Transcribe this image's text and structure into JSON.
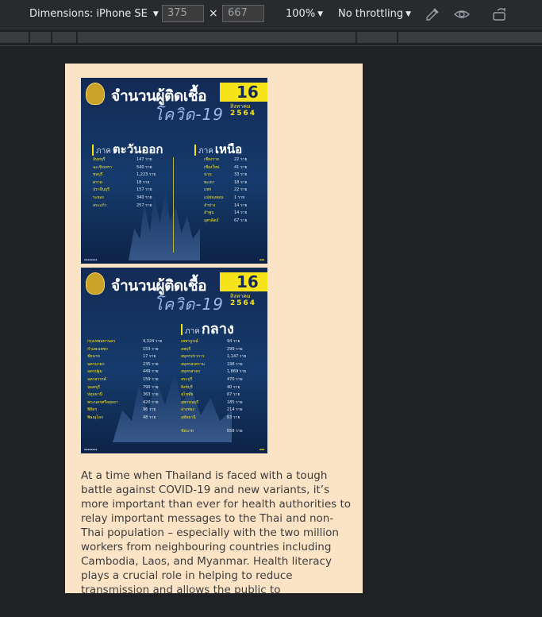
{
  "toolbar": {
    "dimensions_label": "Dimensions: iPhone SE",
    "width": "375",
    "height": "667",
    "times": "×",
    "zoom": "100%",
    "throttling": "No throttling",
    "dropdown_glyph": "▼",
    "icons": [
      "eyedropper-icon",
      "visibility-icon",
      "rotate-icon"
    ]
  },
  "card1": {
    "headline": "จำนวนผู้ติดเชื้อ",
    "subhead": "โควิด-19",
    "day": "16",
    "month": "สิงหาคม",
    "year": "2564",
    "left_region": {
      "prefix": "ภาค",
      "name": "ตะวันออก"
    },
    "right_region": {
      "prefix": "ภาค",
      "name": "เหนือ"
    },
    "left_rows": [
      {
        "p": "จันทบุรี",
        "v": "147 ราย"
      },
      {
        "p": "ฉะเชิงเทรา",
        "v": "540 ราย"
      },
      {
        "p": "ชลบุรี",
        "v": "1,223 ราย"
      },
      {
        "p": "ตราด",
        "v": "18 ราย"
      },
      {
        "p": "ปราจีนบุรี",
        "v": "157 ราย"
      },
      {
        "p": "ระยอง",
        "v": "340 ราย"
      },
      {
        "p": "สระแก้ว",
        "v": "257 ราย"
      }
    ],
    "right_rows": [
      {
        "p": "เชียงราย",
        "v": "22 ราย"
      },
      {
        "p": "เชียงใหม่",
        "v": "41 ราย"
      },
      {
        "p": "น่าน",
        "v": "33 ราย"
      },
      {
        "p": "พะเยา",
        "v": "18 ราย"
      },
      {
        "p": "แพร่",
        "v": "22 ราย"
      },
      {
        "p": "แม่ฮ่องสอน",
        "v": "1 ราย"
      },
      {
        "p": "ลำปาง",
        "v": "14 ราย"
      },
      {
        "p": "ลำพูน",
        "v": "14 ราย"
      },
      {
        "p": "อุตรดิตถ์",
        "v": "67 ราย"
      }
    ]
  },
  "card2": {
    "headline": "จำนวนผู้ติดเชื้อ",
    "subhead": "โควิด-19",
    "day": "16",
    "month": "สิงหาคม",
    "year": "2564",
    "region": {
      "prefix": "ภาค",
      "name": "กลาง"
    },
    "left_rows": [
      {
        "p": "กรุงเทพมหานคร",
        "v": "4,324 ราย"
      },
      {
        "p": "กำแพงเพชร",
        "v": "153 ราย"
      },
      {
        "p": "ชัยนาท",
        "v": "17 ราย"
      },
      {
        "p": "นครนายก",
        "v": "235 ราย"
      },
      {
        "p": "นครปฐม",
        "v": "449 ราย"
      },
      {
        "p": "นครสวรรค์",
        "v": "159 ราย"
      },
      {
        "p": "นนทบุรี",
        "v": "790 ราย"
      },
      {
        "p": "ปทุมธานี",
        "v": "363 ราย"
      },
      {
        "p": "พระนครศรีอยุธยา",
        "v": "420 ราย"
      },
      {
        "p": "พิจิตร",
        "v": "96 ราย"
      },
      {
        "p": "พิษณุโลก",
        "v": "48 ราย"
      }
    ],
    "right_rows": [
      {
        "p": "เพชรบูรณ์",
        "v": "94 ราย"
      },
      {
        "p": "ลพบุรี",
        "v": "299 ราย"
      },
      {
        "p": "สมุทรปราการ",
        "v": "1,147 ราย"
      },
      {
        "p": "สมุทรสงคราม",
        "v": "198 ราย"
      },
      {
        "p": "สมุทรสาคร",
        "v": "1,869 ราย"
      },
      {
        "p": "สระบุรี",
        "v": "470 ราย"
      },
      {
        "p": "สิงห์บุรี",
        "v": "40 ราย"
      },
      {
        "p": "สุโขทัย",
        "v": "67 ราย"
      },
      {
        "p": "สุพรรณบุรี",
        "v": "185 ราย"
      },
      {
        "p": "อ่างทอง",
        "v": "214 ราย"
      },
      {
        "p": "อุทัยธานี",
        "v": "63 ราย"
      },
      {
        "p": "ชัยนาท",
        "v": "658 ราย"
      }
    ]
  },
  "article": {
    "paragraph": "At a time when Thailand is faced with a tough battle against COVID-19 and new variants, it’s more important than ever for health authorities to relay important messages to the Thai and non-Thai population – especially with the two million workers from neighbouring countries including Cambodia, Laos, and Myanmar. Health literacy plays a crucial role in helping to reduce transmission and allows the public to"
  },
  "colors": {
    "toolbar_bg": "#292a2d",
    "page_bg": "#202124",
    "viewport_bg": "#fbe3c5",
    "card_navy": "#132a55",
    "accent_yellow": "#f7e31a"
  }
}
